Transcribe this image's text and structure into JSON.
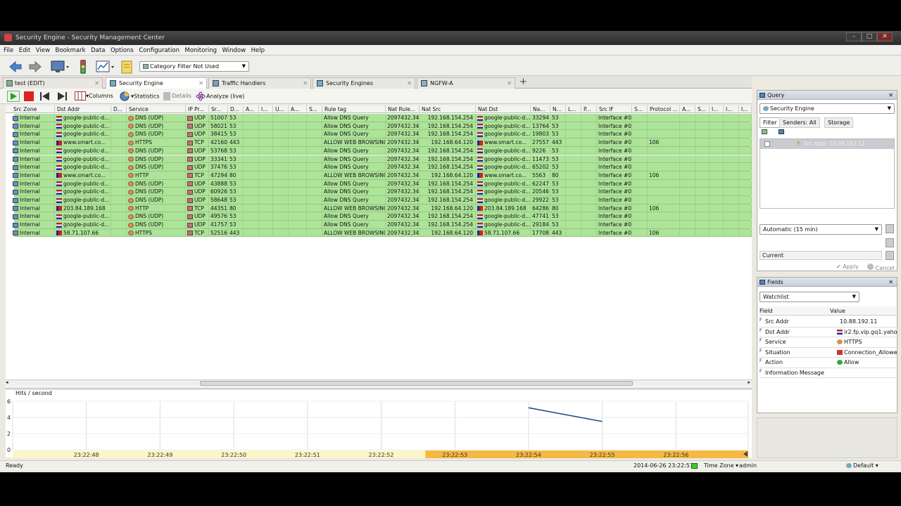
{
  "window": {
    "title": "Security Engine - Security Management Center"
  },
  "menu": [
    "File",
    "Edit",
    "View",
    "Bookmark",
    "Data",
    "Options",
    "Configuration",
    "Monitoring",
    "Window",
    "Help"
  ],
  "toolbar": {
    "category_filter": "Category Filter Not Used"
  },
  "tabs": [
    {
      "label": "test (EDIT)"
    },
    {
      "label": "Security Engine"
    },
    {
      "label": "Traffic Handlers"
    },
    {
      "label": "Security Engines"
    },
    {
      "label": "NGFW-A"
    }
  ],
  "subtoolbar": {
    "columns": "Columns",
    "statistics": "Statistics",
    "details": "Details",
    "analyze": "Analyze (live)"
  },
  "columns": [
    "Src Zone",
    "Dst Addr",
    "D...",
    "Service",
    "IP Pr...",
    "Sr...",
    "D...",
    "A...",
    "I...",
    "U...",
    "A...",
    "S...",
    "Rule tag",
    "Nat Rule...",
    "Nat Src",
    "Nat Dst",
    "Na...",
    "N...",
    "L...",
    "P...",
    "Src IF",
    "S...",
    "Protocol ...",
    "A...",
    "S...",
    "I...",
    "I...",
    "I..."
  ],
  "rows": [
    {
      "zone": "Internal",
      "dst": "google-public-d...",
      "dflag": "us",
      "svc": "DNS (UDP)",
      "proto": "UDP",
      "sport": "51007",
      "dport": "53",
      "tag": "Allow DNS Query",
      "natrule": "2097432.34",
      "natsrc": "192.168.154.254",
      "natdst": "google-public-d...",
      "ndflag": "us",
      "nsport": "33294",
      "ndport": "53",
      "srcif": "Interface #0",
      "protocol": ""
    },
    {
      "zone": "Internal",
      "dst": "google-public-d...",
      "dflag": "us",
      "svc": "DNS (UDP)",
      "proto": "UDP",
      "sport": "58021",
      "dport": "53",
      "tag": "Allow DNS Query",
      "natrule": "2097432.34",
      "natsrc": "192.168.154.254",
      "natdst": "google-public-d...",
      "ndflag": "us",
      "nsport": "13764",
      "ndport": "53",
      "srcif": "Interface #0",
      "protocol": ""
    },
    {
      "zone": "Internal",
      "dst": "google-public-d...",
      "dflag": "us",
      "svc": "DNS (UDP)",
      "proto": "UDP",
      "sport": "38415",
      "dport": "53",
      "tag": "Allow DNS Query",
      "natrule": "2097432.34",
      "natsrc": "192.168.154.254",
      "natdst": "google-public-d...",
      "ndflag": "us",
      "nsport": "19803",
      "ndport": "53",
      "srcif": "Interface #0",
      "protocol": ""
    },
    {
      "zone": "Internal",
      "dst": "www.smart.co...",
      "dflag": "ph",
      "svc": "HTTPS",
      "proto": "TCP",
      "sport": "42160",
      "dport": "443",
      "tag": "ALLOW WEB BROWSING",
      "natrule": "2097432.34",
      "natsrc": "192.168.64.120",
      "natdst": "www.smart.co...",
      "ndflag": "ph",
      "nsport": "27557",
      "ndport": "443",
      "srcif": "Interface #0",
      "protocol": "106"
    },
    {
      "zone": "Internal",
      "dst": "google-public-d...",
      "dflag": "us",
      "svc": "DNS (UDP)",
      "proto": "UDP",
      "sport": "53768",
      "dport": "53",
      "tag": "Allow DNS Query",
      "natrule": "2097432.34",
      "natsrc": "192.168.154.254",
      "natdst": "google-public-d...",
      "ndflag": "us",
      "nsport": "9226",
      "ndport": "53",
      "srcif": "Interface #0",
      "protocol": ""
    },
    {
      "zone": "Internal",
      "dst": "google-public-d...",
      "dflag": "us",
      "svc": "DNS (UDP)",
      "proto": "UDP",
      "sport": "33341",
      "dport": "53",
      "tag": "Allow DNS Query",
      "natrule": "2097432.34",
      "natsrc": "192.168.154.254",
      "natdst": "google-public-d...",
      "ndflag": "us",
      "nsport": "11473",
      "ndport": "53",
      "srcif": "Interface #0",
      "protocol": ""
    },
    {
      "zone": "Internal",
      "dst": "google-public-d...",
      "dflag": "us",
      "svc": "DNS (UDP)",
      "proto": "UDP",
      "sport": "37476",
      "dport": "53",
      "tag": "Allow DNS Query",
      "natrule": "2097432.34",
      "natsrc": "192.168.154.254",
      "natdst": "google-public-d...",
      "ndflag": "us",
      "nsport": "65202",
      "ndport": "53",
      "srcif": "Interface #0",
      "protocol": ""
    },
    {
      "zone": "Internal",
      "dst": "www.smart.co...",
      "dflag": "ph",
      "svc": "HTTP",
      "proto": "TCP",
      "sport": "47294",
      "dport": "80",
      "tag": "ALLOW WEB BROWSING",
      "natrule": "2097432.34",
      "natsrc": "192.168.64.120",
      "natdst": "www.smart.co...",
      "ndflag": "ph",
      "nsport": "5563",
      "ndport": "80",
      "srcif": "Interface #0",
      "protocol": "106"
    },
    {
      "zone": "Internal",
      "dst": "google-public-d...",
      "dflag": "us",
      "svc": "DNS (UDP)",
      "proto": "UDP",
      "sport": "43888",
      "dport": "53",
      "tag": "Allow DNS Query",
      "natrule": "2097432.34",
      "natsrc": "192.168.154.254",
      "natdst": "google-public-d...",
      "ndflag": "us",
      "nsport": "62247",
      "ndport": "53",
      "srcif": "Interface #0",
      "protocol": ""
    },
    {
      "zone": "Internal",
      "dst": "google-public-d...",
      "dflag": "us",
      "svc": "DNS (UDP)",
      "proto": "UDP",
      "sport": "60926",
      "dport": "53",
      "tag": "Allow DNS Query",
      "natrule": "2097432.34",
      "natsrc": "192.168.154.254",
      "natdst": "google-public-d...",
      "ndflag": "us",
      "nsport": "20546",
      "ndport": "53",
      "srcif": "Interface #0",
      "protocol": ""
    },
    {
      "zone": "Internal",
      "dst": "google-public-d...",
      "dflag": "us",
      "svc": "DNS (UDP)",
      "proto": "UDP",
      "sport": "58648",
      "dport": "53",
      "tag": "Allow DNS Query",
      "natrule": "2097432.34",
      "natsrc": "192.168.154.254",
      "natdst": "google-public-d...",
      "ndflag": "us",
      "nsport": "29922",
      "ndport": "53",
      "srcif": "Interface #0",
      "protocol": ""
    },
    {
      "zone": "Internal",
      "dst": "203.84.189.168",
      "dflag": "ph",
      "svc": "HTTP",
      "proto": "TCP",
      "sport": "44351",
      "dport": "80",
      "tag": "ALLOW WEB BROWSING",
      "natrule": "2097432.34",
      "natsrc": "192.168.64.120",
      "natdst": "203.84.189.168",
      "ndflag": "ph",
      "nsport": "64286",
      "ndport": "80",
      "srcif": "Interface #0",
      "protocol": "106"
    },
    {
      "zone": "Internal",
      "dst": "google-public-d...",
      "dflag": "us",
      "svc": "DNS (UDP)",
      "proto": "UDP",
      "sport": "49576",
      "dport": "53",
      "tag": "Allow DNS Query",
      "natrule": "2097432.34",
      "natsrc": "192.168.154.254",
      "natdst": "google-public-d...",
      "ndflag": "us",
      "nsport": "47741",
      "ndport": "53",
      "srcif": "Interface #0",
      "protocol": ""
    },
    {
      "zone": "Internal",
      "dst": "google-public-d...",
      "dflag": "us",
      "svc": "DNS (UDP)",
      "proto": "UDP",
      "sport": "41757",
      "dport": "53",
      "tag": "Allow DNS Query",
      "natrule": "2097432.34",
      "natsrc": "192.168.154.254",
      "natdst": "google-public-d...",
      "ndflag": "us",
      "nsport": "29184",
      "ndport": "53",
      "srcif": "Interface #0",
      "protocol": ""
    },
    {
      "zone": "Internal",
      "dst": "58.71.107.66",
      "dflag": "ph",
      "svc": "HTTPS",
      "proto": "TCP",
      "sport": "52516",
      "dport": "443",
      "tag": "ALLOW WEB BROWSING",
      "natrule": "2097432.34",
      "natsrc": "192.168.64.120",
      "natdst": "58.71.107.66",
      "ndflag": "ph",
      "nsport": "17708",
      "ndport": "443",
      "srcif": "Interface #0",
      "protocol": "106"
    }
  ],
  "hits_chart": {
    "label": "Hits / second",
    "y_ticks": [
      "6",
      "4",
      "2",
      "0"
    ],
    "x_ticks": [
      "23:22:48",
      "23:22:49",
      "23:22:50",
      "23:22:51",
      "23:22:52",
      "23:22:53",
      "23:22:54",
      "23:22:55",
      "23:22:56"
    ],
    "line": [
      {
        "x": "23:22:54",
        "y": 5.2
      },
      {
        "x": "23:22:55",
        "y": 3.5
      }
    ],
    "highlight_color": "#f5b942"
  },
  "query": {
    "title": "Query",
    "target": "Security Engine",
    "tabs": [
      "Filter",
      "Senders: All",
      "Storage"
    ],
    "filter_item": "Src Addr: 10.88.192.11",
    "time_range": "Automatic (15 min)",
    "time_mode": "Current",
    "apply": "Apply",
    "cancel": "Cancel"
  },
  "fields": {
    "title": "Fields",
    "dropdown": "Watchlist",
    "col_field": "Field",
    "col_value": "Value",
    "rows": [
      {
        "k": "Src Addr",
        "v": "10.88.192.11",
        "icon": ""
      },
      {
        "k": "Dst Addr",
        "v": "ir2.fp.vip.gq1.yahoo....",
        "icon": "flag-us-icon"
      },
      {
        "k": "Service",
        "v": "HTTPS",
        "icon": "service-icon"
      },
      {
        "k": "Situation",
        "v": "Connection_Allowed",
        "icon": "flag-icon"
      },
      {
        "k": "Action",
        "v": "Allow",
        "icon": "allow-icon"
      },
      {
        "k": "Information Message",
        "v": "",
        "icon": ""
      }
    ]
  },
  "statusbar": {
    "status": "Ready",
    "datetime": "2014-06-26 23:22:57",
    "timezone": "Time Zone",
    "user": "admin",
    "profile": "Default"
  }
}
